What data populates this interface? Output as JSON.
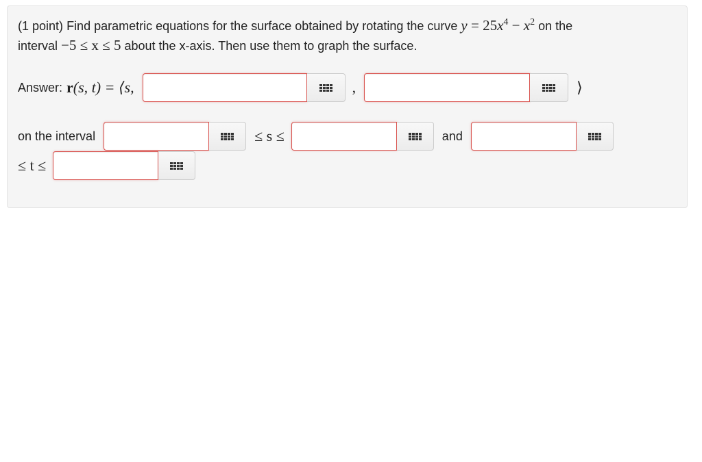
{
  "problem": {
    "points": "(1 point)",
    "text_1": "Find parametric equations for the surface obtained by rotating the curve",
    "curve_lhs": "y",
    "curve_eq": "=",
    "curve_coef": "25",
    "curve_var1": "x",
    "curve_exp1": "4",
    "curve_minus": "−",
    "curve_var2": "x",
    "curve_exp2": "2",
    "text_2": "on the",
    "text_3": "interval",
    "interval_expr": "−5 ≤ x ≤ 5",
    "text_4": "about the x-axis. Then use them to graph the surface."
  },
  "answer": {
    "label": "Answer:",
    "r_expr_bold": "r",
    "r_expr_rest": "(s, t) = ⟨s,",
    "comma": ",",
    "close_bracket": "⟩",
    "input_1_value": "",
    "input_2_value": ""
  },
  "interval_row": {
    "label": "on the interval",
    "s_ineq": "≤ s ≤",
    "and_label": "and",
    "t_ineq": "≤ t ≤",
    "s_lower_value": "",
    "s_upper_value": "",
    "t_lower_value": "",
    "t_upper_value": ""
  },
  "icons": {
    "equation_editor": "grid-icon"
  },
  "colors": {
    "error_border": "#d9534f",
    "panel_bg": "#f5f5f5"
  }
}
